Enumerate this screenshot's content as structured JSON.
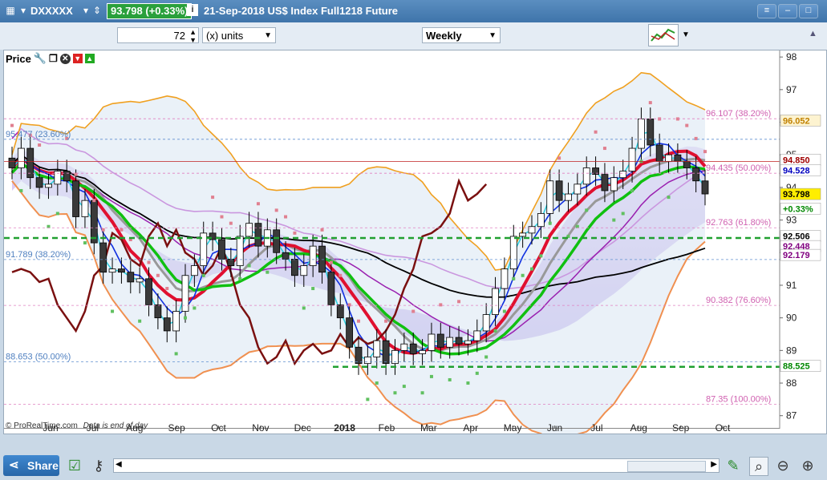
{
  "titlebar": {
    "symbol": "DXXXXX",
    "price_badge": "93.798 (+0.33%)",
    "instrument": "21-Sep-2018 US$ Index Full1218 Future"
  },
  "toolbar": {
    "units_value": "72",
    "units_label": "(x) units",
    "period": "Weekly"
  },
  "panel": {
    "title": "Price"
  },
  "footer": {
    "credit": "© ProRealTime.com",
    "note": "Data is end of day",
    "share_label": "Share"
  },
  "chart_data": {
    "type": "candlestick",
    "y_axis": {
      "range": [
        86.6,
        98.2
      ],
      "ticks": [
        "98",
        "97",
        "96",
        "95",
        "94",
        "93",
        "92",
        "91",
        "90",
        "89",
        "88",
        "87"
      ]
    },
    "x_axis": {
      "ticks": [
        "Jun",
        "Jul",
        "Aug",
        "Sep",
        "Oct",
        "Nov",
        "Dec",
        "2018",
        "Feb",
        "Mar",
        "Apr",
        "May",
        "Jun",
        "Jul",
        "Aug",
        "Sep",
        "Oct"
      ]
    },
    "fib_levels": [
      {
        "label": "96.107 (38.20%)",
        "value": 96.107,
        "side": "right"
      },
      {
        "label": "94.435 (50.00%)",
        "value": 94.435,
        "side": "right"
      },
      {
        "label": "92.763 (61.80%)",
        "value": 92.763,
        "side": "right"
      },
      {
        "label": "90.382 (76.60%)",
        "value": 90.382,
        "side": "right"
      },
      {
        "label": "87.35 (100.00%)",
        "value": 87.35,
        "side": "right"
      },
      {
        "label": "95.477 (23.60%)",
        "value": 95.477,
        "side": "left"
      },
      {
        "label": "91.789 (38.20%)",
        "value": 91.789,
        "side": "left"
      },
      {
        "label": "88.653 (50.00%)",
        "value": 88.653,
        "side": "left"
      }
    ],
    "price_tags": [
      {
        "label": "96.052",
        "value": 96.052,
        "bg": "#fdf3d0",
        "fg": "#c08000"
      },
      {
        "label": "94.850",
        "value": 94.85,
        "bg": "#ffffff",
        "fg": "#a00000"
      },
      {
        "label": "94.528",
        "value": 94.528,
        "bg": "#ffffff",
        "fg": "#0000c0"
      },
      {
        "label": "93.798",
        "value": 93.798,
        "bg": "#ffee00",
        "fg": "#000000"
      },
      {
        "label": "+0.33%",
        "value": 93.35,
        "bg": "#ffffff",
        "fg": "#008800"
      },
      {
        "label": "92.506",
        "value": 92.506,
        "bg": "#ffffff",
        "fg": "#000000"
      },
      {
        "label": "92.448",
        "value": 92.2,
        "bg": "#ffffff",
        "fg": "#800080"
      },
      {
        "label": "92.179",
        "value": 91.93,
        "bg": "#ffffff",
        "fg": "#800080"
      },
      {
        "label": "88.525",
        "value": 88.525,
        "bg": "#ffffff",
        "fg": "#008800"
      }
    ],
    "close_weekly": [
      94.6,
      95.2,
      94.3,
      94.0,
      94.1,
      94.5,
      94.2,
      93.1,
      93.6,
      92.3,
      91.4,
      91.5,
      91.4,
      91.1,
      91.2,
      90.4,
      90.0,
      89.6,
      90.2,
      91.3,
      91.6,
      92.6,
      92.4,
      91.8,
      91.6,
      92.5,
      92.9,
      92.2,
      92.7,
      92.0,
      91.8,
      91.3,
      91.6,
      92.2,
      91.4,
      90.4,
      90.0,
      89.1,
      88.6,
      88.8,
      89.3,
      88.6,
      89.0,
      89.2,
      88.9,
      89.0,
      89.5,
      89.1,
      89.4,
      89.2,
      89.3,
      89.6,
      90.1,
      90.9,
      91.5,
      92.5,
      92.6,
      92.8,
      93.2,
      94.2,
      93.6,
      93.8,
      94.1,
      94.6,
      94.4,
      93.9,
      94.3,
      94.5,
      95.2,
      96.1,
      95.3,
      94.8,
      95.0,
      94.8,
      94.6,
      94.2,
      93.8
    ]
  }
}
